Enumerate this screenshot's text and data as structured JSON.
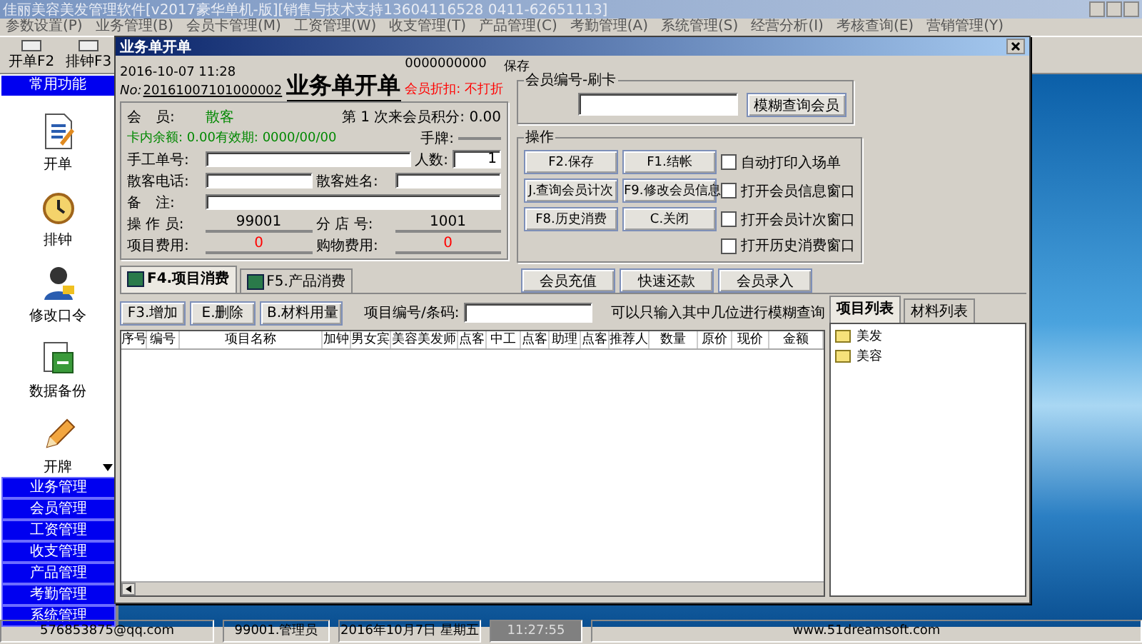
{
  "app": {
    "title": "佳丽美容美发管理软件[v2017豪华单机-版][销售与技术支持13604116528  0411-62651113]"
  },
  "menu": [
    "参数设置(P)",
    "业务管理(B)",
    "会员卡管理(M)",
    "工资管理(W)",
    "收支管理(T)",
    "产品管理(C)",
    "考勤管理(A)",
    "系统管理(S)",
    "经营分析(I)",
    "考核查询(E)",
    "营销管理(Y)"
  ],
  "toolbar": [
    {
      "label": "开单F2"
    },
    {
      "label": "排钟F3"
    }
  ],
  "sidebar": {
    "header": "常用功能",
    "items": [
      {
        "label": "开单",
        "kind": "document"
      },
      {
        "label": "排钟",
        "kind": "clock"
      },
      {
        "label": "修改口令",
        "kind": "user"
      },
      {
        "label": "数据备份",
        "kind": "database"
      },
      {
        "label": "开牌",
        "kind": "pencil"
      }
    ],
    "categories": [
      "业务管理",
      "会员管理",
      "工资管理",
      "收支管理",
      "产品管理",
      "考勤管理",
      "系统管理"
    ]
  },
  "dialog": {
    "title": "业务单开单",
    "datetime": "2016-10-07 11:28",
    "no_label": "No:",
    "order_no": "20161007101000002",
    "heading": "业务单开单",
    "code": "0000000000",
    "save_label": "保存",
    "discount": "会员折扣: 不打折",
    "form": {
      "member_label": "会　员:",
      "member_value": "散客",
      "points": "第 1 次来会员积分: 0.00",
      "balance": "卡内余额: 0.00有效期: 0000/00/00",
      "tag_label": "手牌:",
      "manual_no_label": "手工单号:",
      "people_label": "人数:",
      "people_value": "1",
      "phone_label": "散客电话:",
      "name_label": "散客姓名:",
      "note_label": "备　注:",
      "operator_label": "操 作 员:",
      "operator_value": "99001",
      "branch_label": "分 店 号:",
      "branch_value": "1001",
      "item_fee_label": "项目费用:",
      "item_fee_value": "0",
      "goods_fee_label": "购物费用:",
      "goods_fee_value": "0"
    },
    "card": {
      "title": "会员编号-刷卡",
      "button": "模糊查询会员"
    },
    "operations": {
      "title": "操作",
      "buttons": [
        "F2.保存",
        "F1.结帐",
        "J.查询会员计次",
        "F9.修改会员信息",
        "F8.历史消费",
        "C.关闭"
      ],
      "options": [
        {
          "label": "自动打印入场单",
          "checked": false
        },
        {
          "label": "打开会员信息窗口",
          "checked": false
        },
        {
          "label": "打开会员计次窗口",
          "checked": false
        },
        {
          "label": "打开历史消费窗口",
          "checked": false
        }
      ]
    },
    "member_buttons": [
      "会员充值",
      "快速还款",
      "会员录入"
    ],
    "tabs": [
      {
        "label": "F4.项目消费",
        "selected": true
      },
      {
        "label": "F5.产品消费",
        "selected": false
      }
    ],
    "actions": [
      "F3.增加",
      "E.删除",
      "B.材料用量"
    ],
    "search": {
      "label": "项目编号/条码:",
      "hint": "可以只输入其中几位进行模糊查询"
    },
    "table": {
      "columns": [
        "序号",
        "编号",
        "项目名称",
        "加钟",
        "男女宾",
        "美容美发师",
        "点客",
        "中工",
        "点客",
        "助理",
        "点客",
        "推荐人",
        "数量",
        "原价",
        "现价",
        "金额"
      ]
    },
    "list_tabs": [
      {
        "label": "项目列表",
        "selected": true
      },
      {
        "label": "材料列表",
        "selected": false
      }
    ],
    "tree": [
      {
        "label": "美发"
      },
      {
        "label": "美容"
      }
    ]
  },
  "status_bar": [
    "576853875@qq.com",
    "99001.管理员",
    "2016年10月7日 星期五",
    "11:27:55",
    "www.51dreamsoft.com"
  ]
}
